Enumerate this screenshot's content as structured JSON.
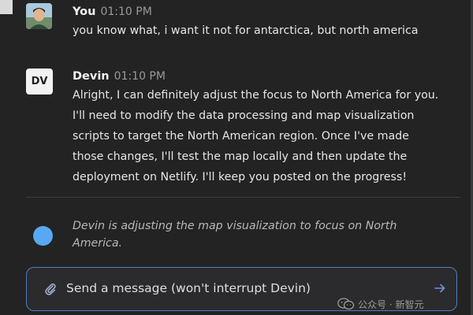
{
  "messages": [
    {
      "author": "You",
      "time": "01:10 PM",
      "avatar": "user-photo-avatar",
      "text": "you know what, i want it not for antarctica, but north america"
    },
    {
      "author": "Devin",
      "time": "01:10 PM",
      "avatar_initials": "DV",
      "text": "Alright, I can definitely adjust the focus to North America for you. I'll need to modify the data processing and map visualization scripts to target the North American region. Once I've made those changes, I'll test the map locally and then update the deployment on Netlify. I'll keep you posted on the progress!"
    }
  ],
  "status": {
    "text": "Devin is adjusting the map visualization to focus on North America.",
    "dot_color": "#58a8f3"
  },
  "composer": {
    "placeholder": "Send a message (won't interrupt Devin)",
    "value": "",
    "attach_icon": "paperclip-icon",
    "send_icon": "send-arrow-icon",
    "border_color": "#4d7fbe"
  },
  "watermark": {
    "text": "公众号 · 新智元",
    "icon": "wechat-icon"
  },
  "colors": {
    "background": "#232323",
    "text": "#e6e6e6",
    "muted": "#9a9a9a"
  }
}
